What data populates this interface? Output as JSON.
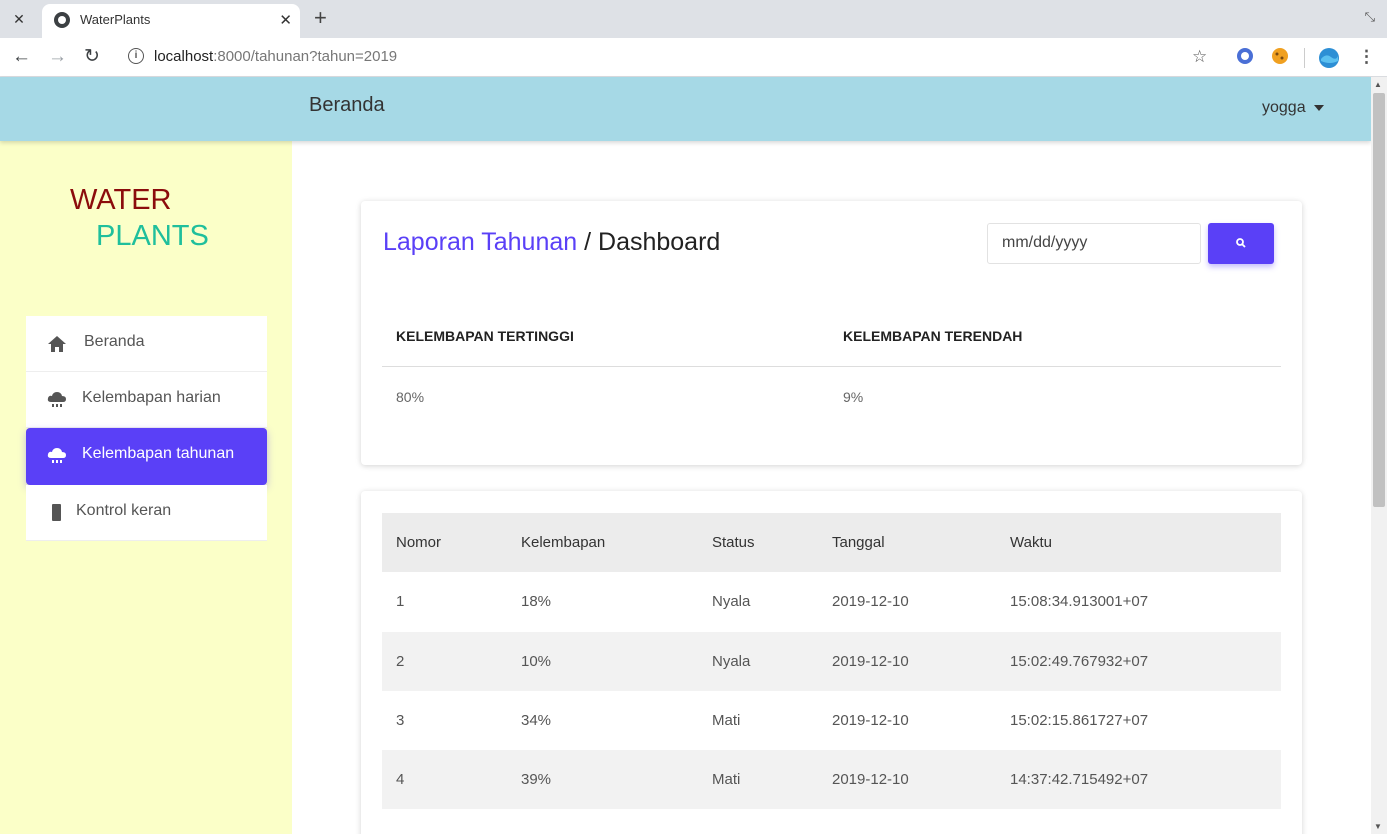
{
  "browser": {
    "tab_title": "WaterPlants",
    "url_host": "localhost",
    "url_rest": ":8000/tahunan?tahun=2019",
    "info_glyph": "i"
  },
  "header": {
    "title": "Beranda",
    "user": "yogga"
  },
  "logo": {
    "line1": "WATER",
    "line2": "PLANTS"
  },
  "sidebar": {
    "items": [
      {
        "label": "Beranda",
        "icon": "home-icon"
      },
      {
        "label": "Kelembapan harian",
        "icon": "cloud-rain-icon"
      },
      {
        "label": "Kelembapan tahunan",
        "icon": "cloud-rain-icon",
        "active": true
      },
      {
        "label": "Kontrol keran",
        "icon": "mobile-icon"
      }
    ]
  },
  "report": {
    "title_link": "Laporan Tahunan",
    "title_sep": " / ",
    "title_rest": "Dashboard",
    "date_placeholder": "mm/dd/yyyy",
    "highest_label": "KELEMBAPAN TERTINGGI",
    "lowest_label": "KELEMBAPAN TERENDAH",
    "highest_value": "80%",
    "lowest_value": "9%"
  },
  "table": {
    "columns": [
      "Nomor",
      "Kelembapan",
      "Status",
      "Tanggal",
      "Waktu"
    ],
    "rows": [
      [
        "1",
        "18%",
        "Nyala",
        "2019-12-10",
        "15:08:34.913001+07"
      ],
      [
        "2",
        "10%",
        "Nyala",
        "2019-12-10",
        "15:02:49.767932+07"
      ],
      [
        "3",
        "34%",
        "Mati",
        "2019-12-10",
        "15:02:15.861727+07"
      ],
      [
        "4",
        "39%",
        "Mati",
        "2019-12-10",
        "14:37:42.715492+07"
      ]
    ]
  },
  "colors": {
    "accent": "#5a40f7",
    "topbar": "#a6d9e6",
    "sidebar": "#fbffc8",
    "logo_water": "#8b0c0c",
    "logo_plants": "#1fbf9c"
  }
}
